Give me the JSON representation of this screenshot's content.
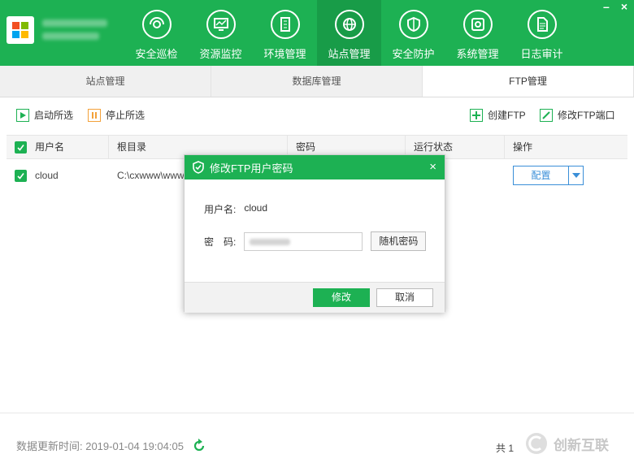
{
  "header": {
    "nav": [
      {
        "label": "安全巡检",
        "icon": "eye-scan-icon"
      },
      {
        "label": "资源监控",
        "icon": "monitor-chart-icon"
      },
      {
        "label": "环境管理",
        "icon": "building-icon"
      },
      {
        "label": "站点管理",
        "icon": "globe-icon"
      },
      {
        "label": "安全防护",
        "icon": "shield-icon"
      },
      {
        "label": "系统管理",
        "icon": "gear-icon"
      },
      {
        "label": "日志审计",
        "icon": "document-icon"
      }
    ],
    "active_nav": "站点管理",
    "minimize_label": "–",
    "close_label": "×",
    "accent": "#1db153"
  },
  "subtabs": [
    "站点管理",
    "数据库管理",
    "FTP管理"
  ],
  "active_subtab": "FTP管理",
  "toolbar": {
    "start_selected": "启动所选",
    "stop_selected": "停止所选",
    "create_ftp": "创建FTP",
    "modify_ftp_port": "修改FTP端口"
  },
  "table": {
    "columns": [
      "用户名",
      "根目录",
      "密码",
      "运行状态",
      "操作"
    ],
    "rows": [
      {
        "username": "cloud",
        "root": "C:\\cxwww\\www",
        "action": "配置"
      }
    ]
  },
  "dialog": {
    "title": "修改FTP用户密码",
    "username_label": "用户名:",
    "username_value": "cloud",
    "password_label": "密　码:",
    "random_button": "随机密码",
    "ok_button": "修改",
    "cancel_button": "取消",
    "close_label": "×"
  },
  "footer": {
    "update_time": "数据更新时间: 2019-01-04 19:04:05",
    "total": "共 1",
    "watermark": "创新互联"
  }
}
